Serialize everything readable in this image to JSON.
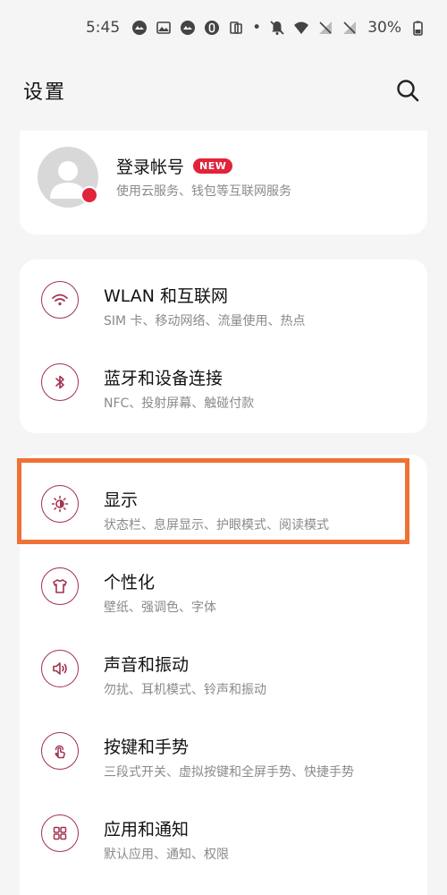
{
  "status_bar": {
    "time": "5:45",
    "dot": "•",
    "battery_percent": "30%",
    "icons": [
      "notification-icon",
      "gallery-icon",
      "notification-icon",
      "vpn-icon",
      "clipboard-icon",
      "mute-icon",
      "wifi-icon",
      "signal-icon",
      "signal-icon",
      "battery-icon"
    ]
  },
  "header": {
    "title": "设置",
    "search_icon": "search-icon"
  },
  "account": {
    "title": "登录帐号",
    "badge": "NEW",
    "subtitle": "使用云服务、钱包等互联网服务"
  },
  "network_group": [
    {
      "title": "WLAN 和互联网",
      "subtitle": "SIM 卡、移动网络、流量使用、热点",
      "icon": "wifi-icon"
    },
    {
      "title": "蓝牙和设备连接",
      "subtitle": "NFC、投射屏幕、触碰付款",
      "icon": "bluetooth-icon"
    }
  ],
  "main_group": [
    {
      "title": "显示",
      "subtitle": "状态栏、息屏显示、护眼模式、阅读模式",
      "icon": "brightness-icon"
    },
    {
      "title": "个性化",
      "subtitle": "壁纸、强调色、字体",
      "icon": "tshirt-icon"
    },
    {
      "title": "声音和振动",
      "subtitle": "勿扰、耳机模式、铃声和振动",
      "icon": "speaker-icon"
    },
    {
      "title": "按键和手势",
      "subtitle": "三段式开关、虚拟按键和全屏手势、快捷手势",
      "icon": "gesture-icon"
    },
    {
      "title": "应用和通知",
      "subtitle": "默认应用、通知、权限",
      "icon": "apps-icon"
    }
  ],
  "colors": {
    "accent": "#a3324f",
    "badge": "#e0243a",
    "highlight": "#ef7133",
    "background": "#f5f5f5"
  }
}
